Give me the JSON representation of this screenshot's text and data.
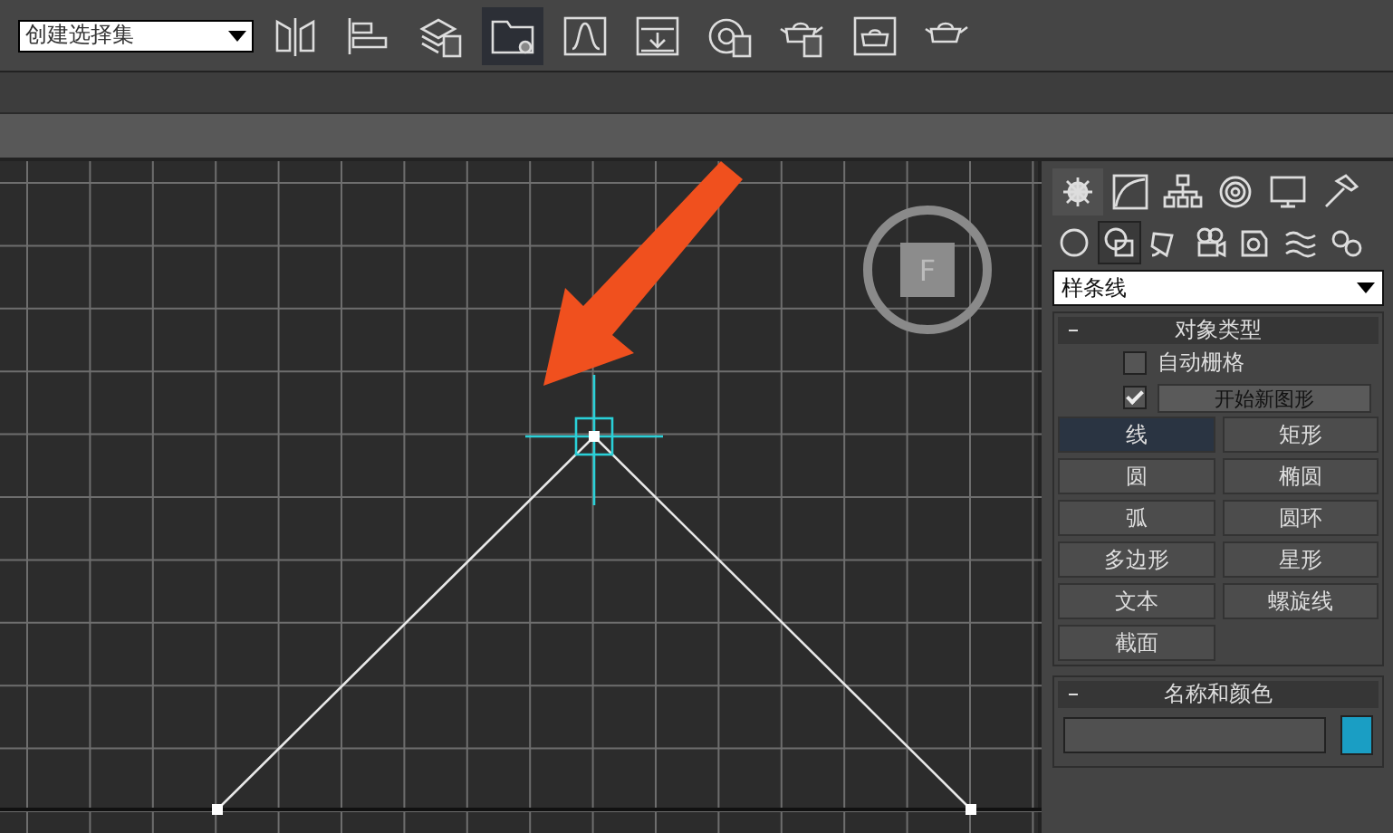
{
  "toolbar": {
    "selection_set": {
      "value": "创建选择集"
    },
    "tools": [
      {
        "kind": "mirror",
        "selected": false
      },
      {
        "kind": "align",
        "selected": false
      },
      {
        "kind": "layers",
        "selected": false
      },
      {
        "kind": "explorer",
        "selected": true
      },
      {
        "kind": "curve",
        "selected": false
      },
      {
        "kind": "schematic",
        "selected": false
      },
      {
        "kind": "material",
        "selected": false
      },
      {
        "kind": "teapot-setup",
        "selected": false
      },
      {
        "kind": "teapot-frame",
        "selected": false
      },
      {
        "kind": "teapot",
        "selected": false
      }
    ]
  },
  "viewport": {
    "viewcube": {
      "label": "F"
    }
  },
  "command_panel": {
    "tabs": [
      {
        "kind": "create",
        "selected": true
      },
      {
        "kind": "modify",
        "selected": false
      },
      {
        "kind": "hierarchy",
        "selected": false
      },
      {
        "kind": "motion",
        "selected": false
      },
      {
        "kind": "display",
        "selected": false
      },
      {
        "kind": "utilities",
        "selected": false
      }
    ],
    "categories": [
      {
        "kind": "geometry",
        "selected": false
      },
      {
        "kind": "shapes",
        "selected": true
      },
      {
        "kind": "lights",
        "selected": false
      },
      {
        "kind": "cameras",
        "selected": false
      },
      {
        "kind": "helpers",
        "selected": false
      },
      {
        "kind": "spacewarps",
        "selected": false
      },
      {
        "kind": "systems",
        "selected": false
      }
    ],
    "subcategory": {
      "value": "样条线"
    },
    "object_type": {
      "title": "对象类型",
      "auto_grid": {
        "label": "自动栅格",
        "checked": false
      },
      "start_new_shape": {
        "label": "开始新图形",
        "checked": true
      },
      "buttons": [
        {
          "label": "线",
          "selected": true
        },
        {
          "label": "矩形",
          "selected": false
        },
        {
          "label": "圆",
          "selected": false
        },
        {
          "label": "椭圆",
          "selected": false
        },
        {
          "label": "弧",
          "selected": false
        },
        {
          "label": "圆环",
          "selected": false
        },
        {
          "label": "多边形",
          "selected": false
        },
        {
          "label": "星形",
          "selected": false
        },
        {
          "label": "文本",
          "selected": false
        },
        {
          "label": "螺旋线",
          "selected": false
        },
        {
          "label": "截面",
          "selected": false
        }
      ]
    },
    "name_and_color": {
      "title": "名称和颜色",
      "color": "#1a9ec4"
    }
  }
}
